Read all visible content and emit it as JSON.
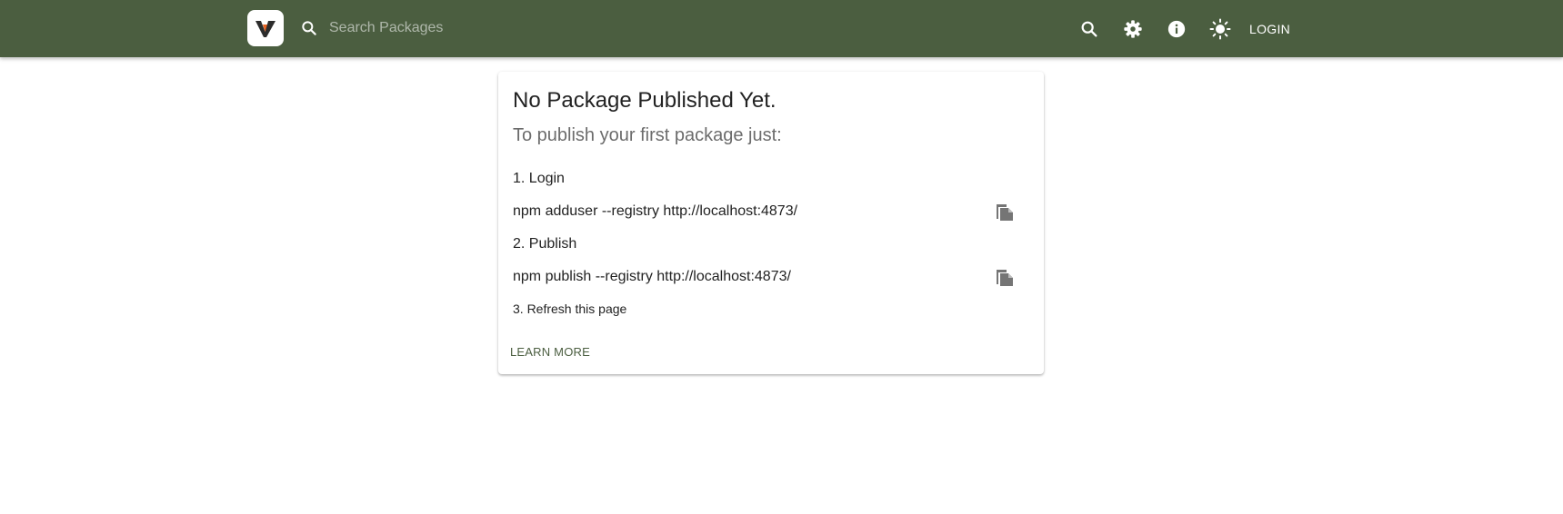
{
  "header": {
    "search": {
      "placeholder": "Search Packages",
      "value": ""
    },
    "login_label": "LOGIN",
    "icons": [
      "logo-icon",
      "search-icon",
      "settings-icon",
      "info-icon",
      "theme-toggle-icon"
    ]
  },
  "card": {
    "title": "No Package Published Yet.",
    "subtitle": "To publish your first package just:",
    "steps": [
      {
        "label": "1. Login",
        "command": "npm adduser --registry http://localhost:4873/"
      },
      {
        "label": "2. Publish",
        "command": "npm publish --registry http://localhost:4873/"
      },
      {
        "label": "3. Refresh this page"
      }
    ],
    "learn_more_label": "LEARN MORE"
  },
  "colors": {
    "header_bg": "#4b5e40",
    "logo_accent": "#e8621f",
    "logo_dark": "#2c2c2c",
    "subtitle_text": "#6c6c6c",
    "copy_icon": "#757575"
  }
}
